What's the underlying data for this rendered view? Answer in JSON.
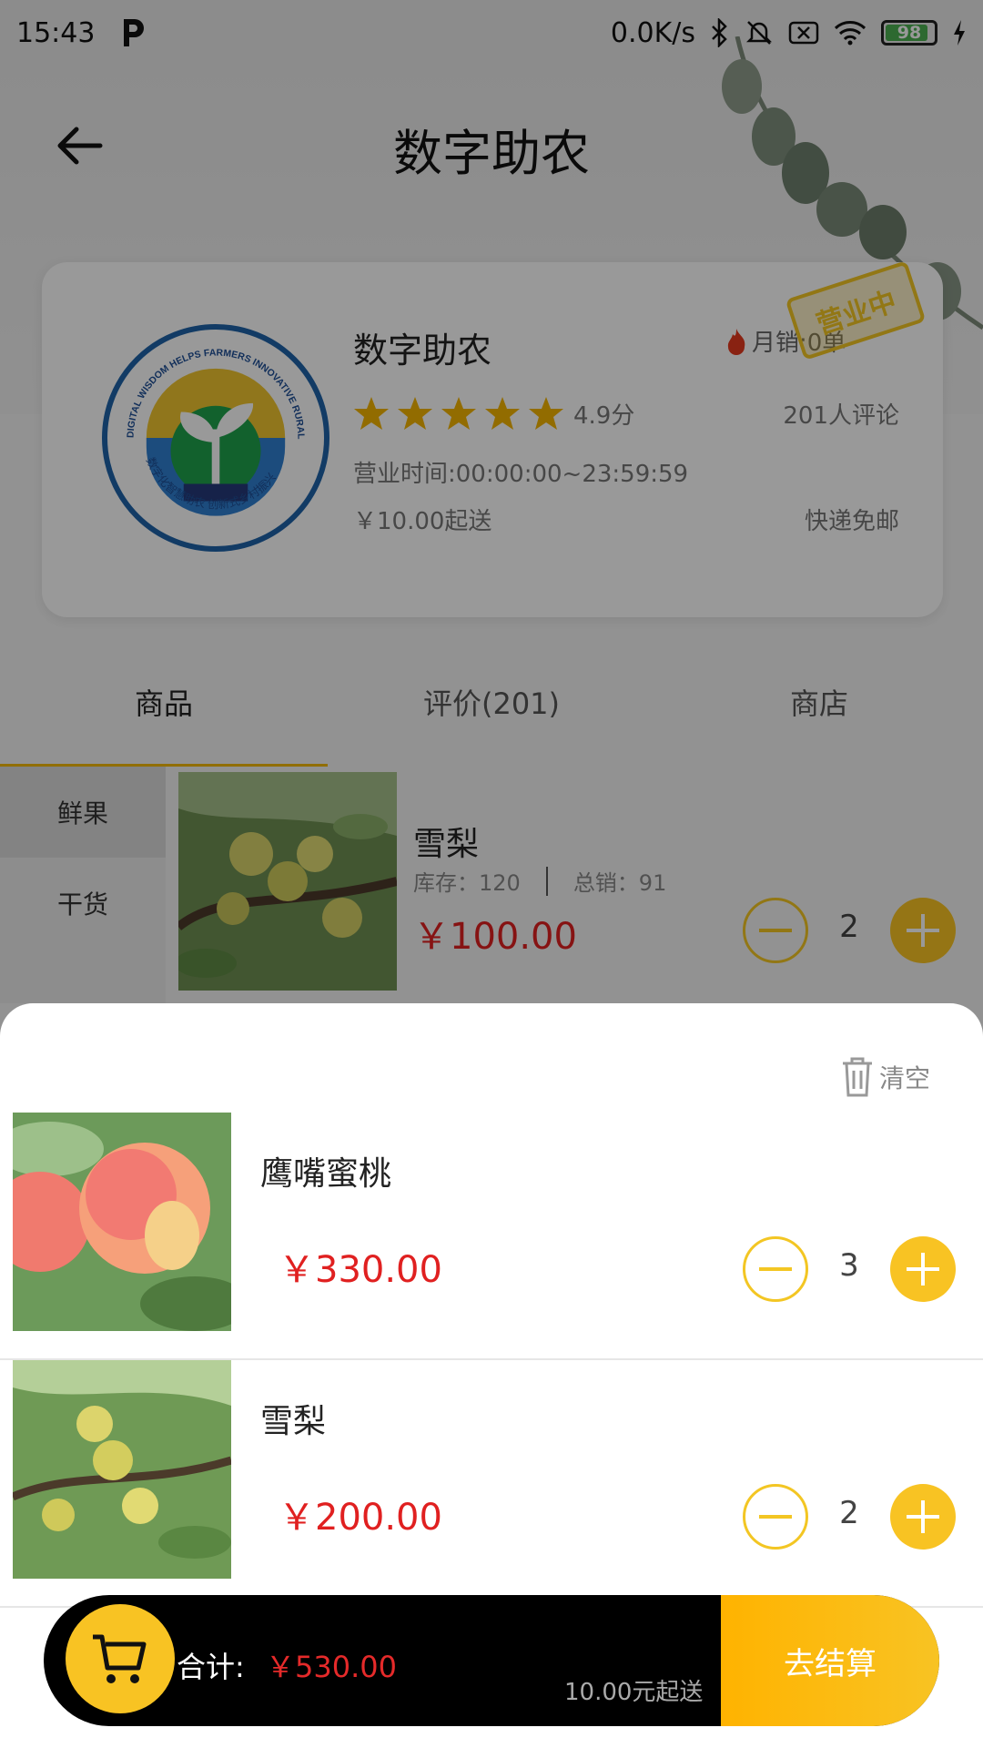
{
  "status_bar": {
    "time": "15:43",
    "network_speed": "0.0K/s",
    "battery": "98"
  },
  "nav": {
    "title": "数字助农"
  },
  "shop": {
    "name": "数字助农",
    "monthly_sales": "月销:0单",
    "stamp": "营业中",
    "rating": "4.9分",
    "stars": 5,
    "reviews": "201人评论",
    "hours": "营业时间:00:00:00~23:59:59",
    "min_order": "￥10.00起送",
    "shipping": "快递免邮",
    "logo_text_top": "DIGITAL WISDOM HELPS FARMERS INNOVATIVE RURAL REVITALIZATION",
    "logo_text_bottom": "数字化智慧助农 创新式乡村振兴"
  },
  "tabs": [
    {
      "label": "商品",
      "active": true
    },
    {
      "label": "评价(201)",
      "active": false
    },
    {
      "label": "商店",
      "active": false
    }
  ],
  "categories": [
    {
      "label": "鲜果",
      "active": true
    },
    {
      "label": "干货",
      "active": false
    }
  ],
  "product": {
    "name": "雪梨",
    "stock": "库存：120",
    "sold": "总销：91",
    "price": "￥100.00",
    "qty": "2"
  },
  "cart": {
    "clear_label": "清空",
    "items": [
      {
        "name": "鹰嘴蜜桃",
        "price": "￥330.00",
        "qty": "3"
      },
      {
        "name": "雪梨",
        "price": "￥200.00",
        "qty": "2"
      }
    ],
    "total_label": "合计:",
    "total_value": "￥530.00",
    "min_note": "10.00元起送",
    "checkout_label": "去结算"
  },
  "colors": {
    "accent": "#f8c323",
    "price": "#e02020"
  }
}
